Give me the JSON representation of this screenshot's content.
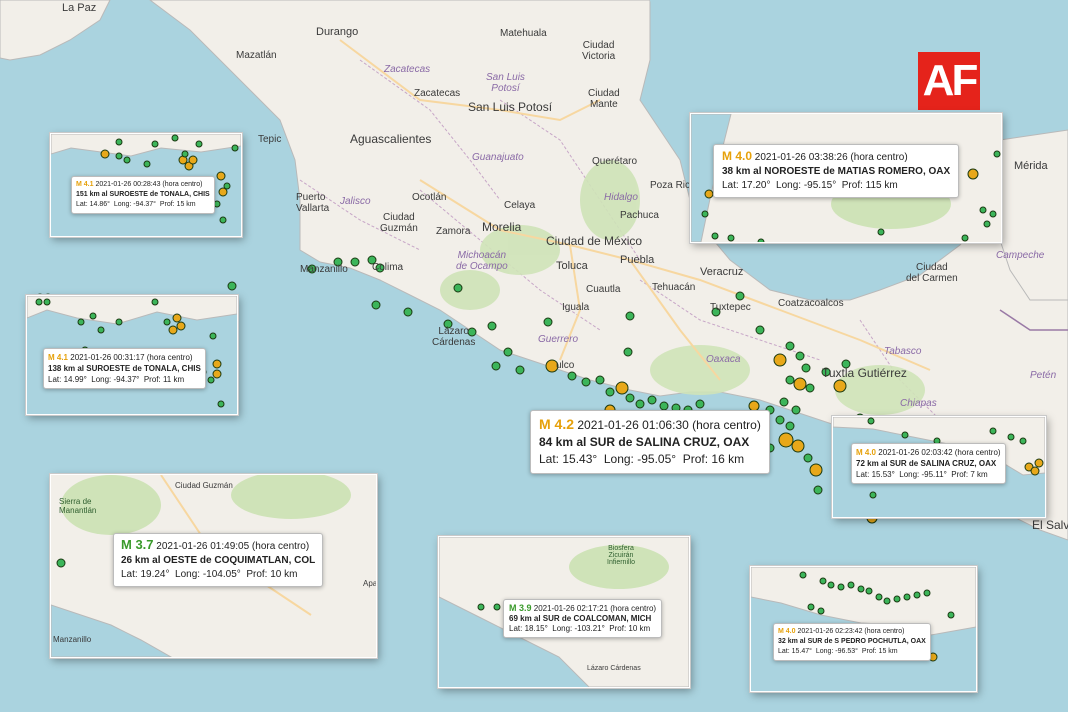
{
  "logo": {
    "text": "AF",
    "color": "#e5231b"
  },
  "colors": {
    "sea": "#aad3df",
    "land": "#f2efe9",
    "quake_green": "#3cb55a",
    "quake_yellow": "#e8a81a"
  },
  "map_labels": {
    "la_paz": "La Paz",
    "durango": "Durango",
    "matehuala": "Matehuala",
    "ciudad_victoria": "Ciudad\nVictoria",
    "mazatlan": "Mazatlán",
    "zacatecas_state": "Zacatecas",
    "san_luis_potosi_state": "San Luis\nPotosí",
    "zacatecas": "Zacatecas",
    "ciudad_mante": "Ciudad\nMante",
    "san_luis_potosi": "San Luis Potosí",
    "aguascalientes": "Aguascalientes",
    "tepic": "Tepic",
    "guanajuato_state": "Guanajuato",
    "queretaro": "Querétaro",
    "poza_rica": "Poza Ric",
    "hidalgo": "Hidalgo",
    "puerto_vallarta": "Puerto\nVallarta",
    "ocotlan": "Ocotlán",
    "jalisco": "Jalisco",
    "celaya": "Celaya",
    "ciudad_guzman": "Ciudad\nGuzmán",
    "zamora": "Zamora",
    "morelia": "Morelia",
    "ciudad_de_mexico": "Ciudad de México",
    "pachuca": "Pachuca",
    "michoacan": "Michoacán\nde Ocampo",
    "toluca": "Toluca",
    "puebla": "Puebla",
    "veracruz": "Veracruz",
    "manzanillo": "Manzanillo",
    "colima": "Colima",
    "cuautla": "Cuautla",
    "tehuacan": "Tehuacán",
    "iguala": "Iguala",
    "tuxtepec": "Tuxtepec",
    "coatzacoalcos": "Coatzacoalcos",
    "lazaro_cardenas": "Lázaro\nCárdenas",
    "guerrero": "Guerrero",
    "oaxaca": "Oaxaca",
    "acapulco": "ulco",
    "tuxtla_gutierrez": "Tuxtla Gutiérrez",
    "chiapas": "Chiapas",
    "tabasco": "Tabasco",
    "ciudad_del_carmen": "Ciudad\ndel Carmen",
    "campeche": "Campeche",
    "merida": "Mérida",
    "peten": "Petén",
    "el_salvador": "El Salv"
  },
  "insets": {
    "i1": {
      "mag": "M 4.1",
      "datetime": "2021-01-26  00:28:43 (hora centro)",
      "place": "151 km al SUROESTE de TONALA, CHIS",
      "lat": "Lat: 14.86°",
      "long": "Long: -94.37°",
      "depth": "Prof: 15 km"
    },
    "i2": {
      "mag": "M 4.1",
      "datetime": "2021-01-26  00:31:17 (hora centro)",
      "place": "138 km al SUROESTE de TONALA, CHIS",
      "lat": "Lat: 14.99°",
      "long": "Long: -94.37°",
      "depth": "Prof: 11 km"
    },
    "i3": {
      "mag": "M 3.7",
      "datetime": "2021-01-26  01:49:05 (hora centro)",
      "place": "26 km al OESTE de COQUIMATLAN, COL",
      "lat": "Lat: 19.24°",
      "long": "Long: -104.05°",
      "depth": "Prof: 10 km",
      "labels": {
        "guzman": "Ciudad Guzmán",
        "sierra": "Sierra de\nManantlán",
        "manzanillo": "Manzanillo",
        "apa": "Apa"
      }
    },
    "i4": {
      "mag": "M 3.9",
      "datetime": "2021-01-26  02:17:21 (hora centro)",
      "place": "69 km al SUR de COALCOMAN, MICH",
      "lat": "Lat: 18.15°",
      "long": "Long: -103.21°",
      "depth": "Prof: 10 km",
      "labels": {
        "biosfera": "Biosfera\nZicuirán\nInfiernillo",
        "lazaro": "Lázaro Cárdenas"
      }
    },
    "i5": {
      "mag": "M 4.0",
      "datetime": "2021-01-26  02:23:42 (hora centro)",
      "place": "32 km al SUR de S PEDRO POCHUTLA, OAX",
      "lat": "Lat: 15.47°",
      "long": "Long: -96.53°",
      "depth": "Prof: 15 km"
    },
    "i6": {
      "mag": "M 4.0",
      "datetime": "2021-01-26  03:38:26 (hora centro)",
      "place": "38 km al NOROESTE de MATIAS ROMERO, OAX",
      "lat": "Lat: 17.20°",
      "long": "Long: -95.15°",
      "depth": "Prof: 115 km"
    },
    "i7": {
      "mag": "M 4.0",
      "datetime": "2021-01-26  02:03:42 (hora centro)",
      "place": "72 km al SUR de SALINA CRUZ, OAX",
      "lat": "Lat: 15.53°",
      "long": "Long: -95.11°",
      "depth": "Prof: 7 km"
    }
  },
  "main_popup": {
    "mag": "M 4.2",
    "datetime": "2021-01-26  01:06:30 (hora centro)",
    "place": "84 km al SUR de SALINA CRUZ, OAX",
    "lat": "Lat: 15.43°",
    "long": "Long: -95.05°",
    "depth": "Prof: 16 km"
  }
}
